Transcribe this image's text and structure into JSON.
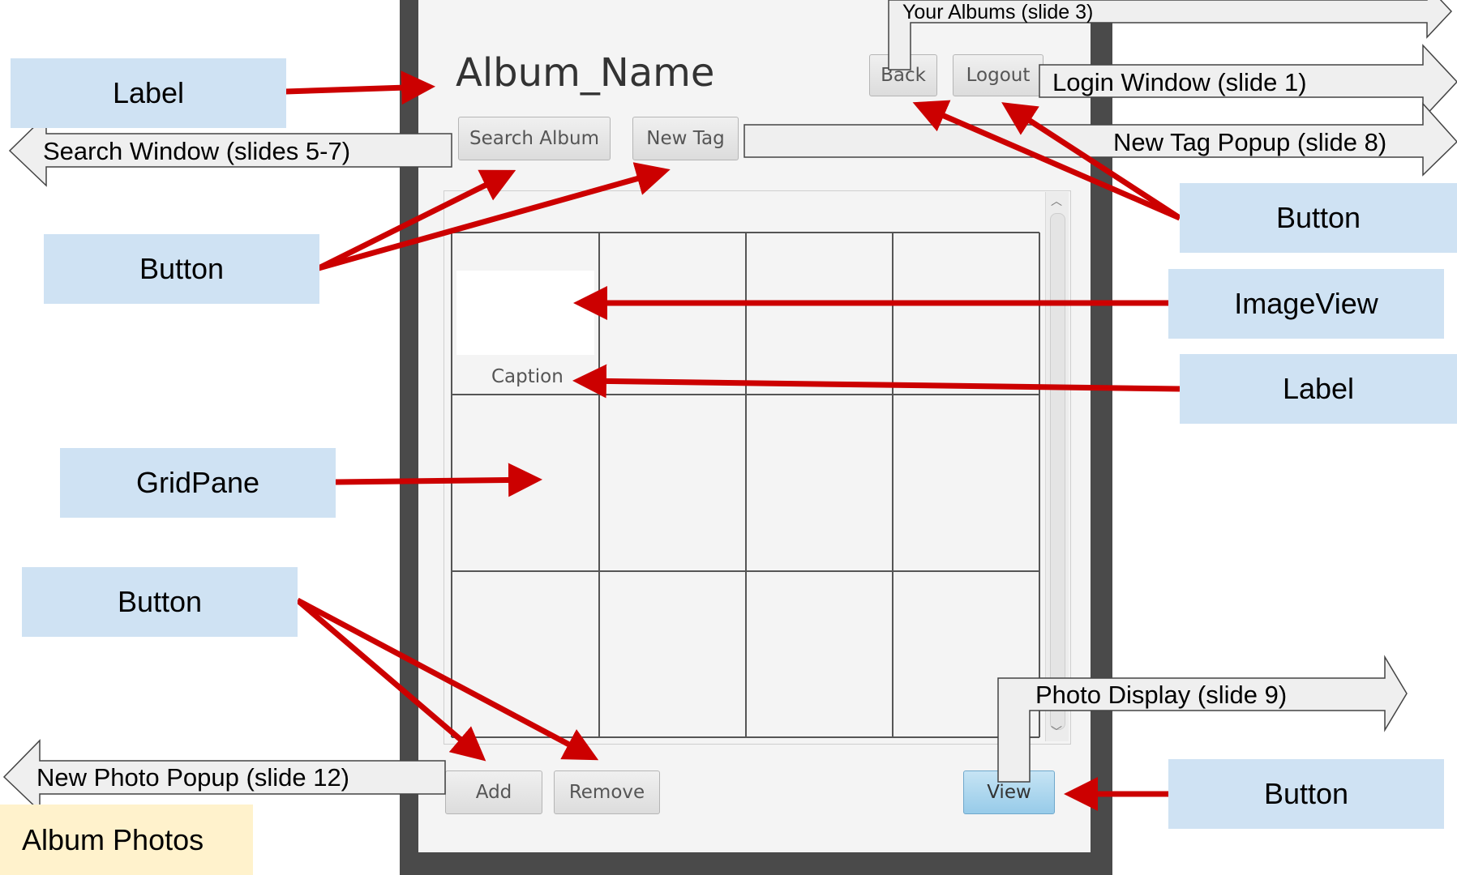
{
  "window": {
    "album_title": "Album_Name",
    "buttons": {
      "back": "Back",
      "logout": "Logout",
      "search_album": "Search Album",
      "new_tag": "New Tag",
      "add": "Add",
      "remove": "Remove",
      "view": "View"
    },
    "caption": "Caption"
  },
  "callouts": {
    "label_top": "Label",
    "button_left_top": "Button",
    "gridpane": "GridPane",
    "button_left_bottom": "Button",
    "button_right_top": "Button",
    "imageview": "ImageView",
    "label_right": "Label",
    "button_right_bottom": "Button"
  },
  "navigation": {
    "your_albums": "Your Albums (slide 3)",
    "login_window": "Login Window (slide 1)",
    "search_window": "Search Window (slides 5-7)",
    "new_tag_popup": "New Tag Popup (slide 8)",
    "photo_display": "Photo Display (slide 9)",
    "new_photo_popup": "New Photo Popup (slide 12)"
  },
  "slide_label": "Album Photos",
  "colors": {
    "callout_fill": "#cfe2f3",
    "arrow_red": "#cc0000",
    "badge_fill": "#fff2cc",
    "frame": "#4a4a4a",
    "nav_arrow_fill": "#efefef"
  }
}
